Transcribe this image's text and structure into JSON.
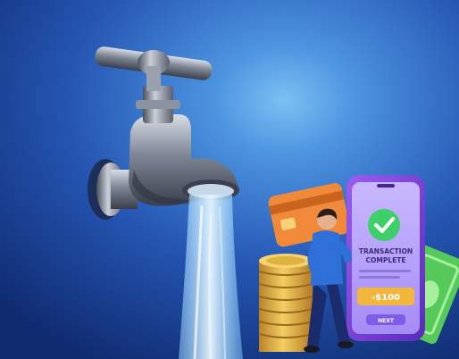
{
  "phone": {
    "status_title": "TRANSACTION COMPLETE",
    "status_line1": "TRANSACTION",
    "status_line2": "COMPLETE",
    "amount": "-$100",
    "button_label": "NEXT"
  },
  "colors": {
    "wall_highlight": "#5fa9ea",
    "wall_mid": "#2b66c0",
    "wall_dark": "#12307a",
    "phone_frame": "#7a3fd6",
    "screen": "#b7a3ff",
    "check_green": "#3ecf6a",
    "card_orange": "#f08a3a",
    "bill_green": "#55c95a",
    "coin_gold": "#e2b43a"
  },
  "icons": [
    "water-tap-icon",
    "checkmark-icon",
    "credit-card-icon",
    "banknote-icon",
    "coin-stack-icon",
    "person-figure-icon"
  ]
}
